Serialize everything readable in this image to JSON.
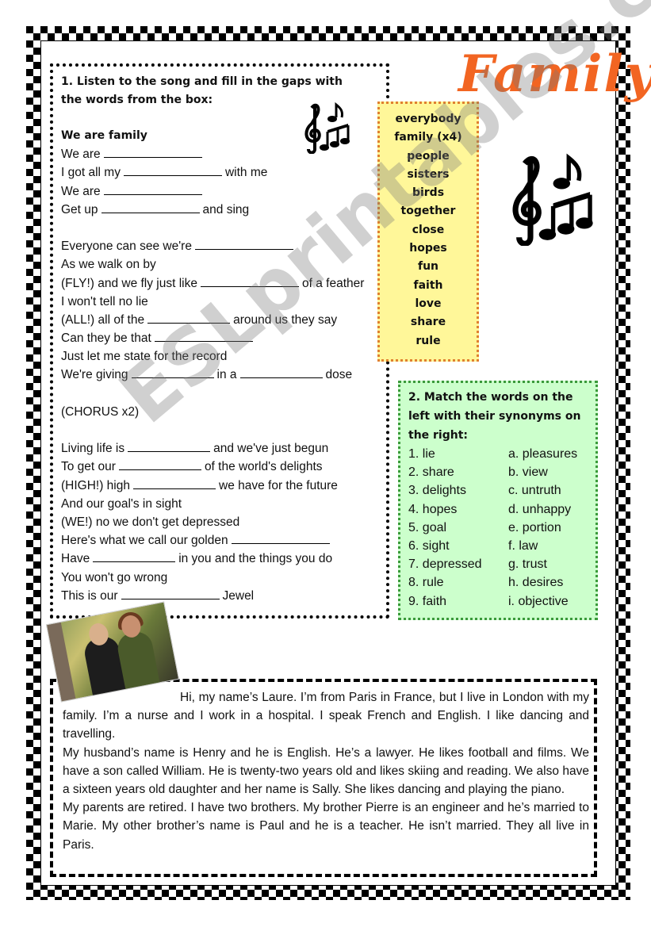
{
  "title": "Family",
  "exercise1": {
    "instruction": "1. Listen to the song and fill in the gaps with the words from the box:",
    "song_title": "We are family",
    "lines": [
      {
        "before": "We are",
        "gaps": 1,
        "mid": "",
        "after": ""
      },
      {
        "before": "I got all my",
        "gaps": 1,
        "mid": "",
        "after": "with me"
      },
      {
        "before": "We are",
        "gaps": 1,
        "mid": "",
        "after": ""
      },
      {
        "before": "Get up",
        "gaps": 1,
        "mid": "",
        "after": "and sing"
      },
      {
        "before": "",
        "gaps": 0,
        "mid": "",
        "after": ""
      },
      {
        "before": "Everyone can see we're",
        "gaps": 1,
        "mid": "",
        "after": ""
      },
      {
        "before": "As we walk on by",
        "gaps": 0,
        "mid": "",
        "after": ""
      },
      {
        "before": "(FLY!) and we fly just like",
        "gaps": 1,
        "mid": "",
        "after": "of a feather"
      },
      {
        "before": "I won't tell no lie",
        "gaps": 0,
        "mid": "",
        "after": ""
      },
      {
        "before": "(ALL!) all of the",
        "gaps": 1,
        "mid": "",
        "after": "around us they say"
      },
      {
        "before": "Can they be that",
        "gaps": 1,
        "mid": "",
        "after": ""
      },
      {
        "before": "Just let me state for the record",
        "gaps": 0,
        "mid": "",
        "after": ""
      },
      {
        "before": "We're giving",
        "gaps": 2,
        "mid": "in a",
        "after": "dose"
      },
      {
        "before": "",
        "gaps": 0,
        "mid": "",
        "after": ""
      },
      {
        "before": "(CHORUS x2)",
        "gaps": 0,
        "mid": "",
        "after": ""
      },
      {
        "before": "",
        "gaps": 0,
        "mid": "",
        "after": ""
      },
      {
        "before": "Living life is",
        "gaps": 1,
        "mid": "",
        "after": "and we've just begun"
      },
      {
        "before": "To get our",
        "gaps": 1,
        "mid": "",
        "after": "of the world's delights"
      },
      {
        "before": "(HIGH!) high",
        "gaps": 1,
        "mid": "",
        "after": "we have for the future"
      },
      {
        "before": "And our goal's in sight",
        "gaps": 0,
        "mid": "",
        "after": ""
      },
      {
        "before": "(WE!) no we don't get depressed",
        "gaps": 0,
        "mid": "",
        "after": ""
      },
      {
        "before": "Here's what we call our golden",
        "gaps": 1,
        "mid": "",
        "after": ""
      },
      {
        "before": "Have",
        "gaps": 1,
        "mid": "",
        "after": "in you and the things you do"
      },
      {
        "before": "You won't go wrong",
        "gaps": 0,
        "mid": "",
        "after": ""
      },
      {
        "before": "This is our",
        "gaps": 1,
        "mid": "",
        "after": "Jewel"
      }
    ]
  },
  "word_box": {
    "words": [
      "everybody",
      "family (x4)",
      "people",
      "sisters",
      "birds",
      "together",
      "close",
      "hopes",
      "fun",
      "faith",
      "love",
      "share",
      "rule"
    ]
  },
  "exercise2": {
    "instruction": "2. Match the words on the left with their synonyms on the right:",
    "left": [
      "1. lie",
      "2. share",
      "3. delights",
      "4. hopes",
      "5. goal",
      "6. sight",
      "7. depressed",
      "8. rule",
      "9. faith"
    ],
    "right": [
      "a. pleasures",
      "b. view",
      "c. untruth",
      "d. unhappy",
      "e. portion",
      "f. law",
      "g. trust",
      "h. desires",
      "i. objective"
    ]
  },
  "reading": {
    "paragraphs": [
      "Hi, my name’s Laure. I’m from Paris in France, but I live in London with my family. I’m a nurse and I work in a hospital. I speak French and English. I like dancing and travelling.",
      "My husband’s name is Henry and he is English. He’s a lawyer. He likes football and films. We have a son called William. He is twenty-two years old and likes skiing and reading. We also have a sixteen years old daughter and her name is Sally. She likes dancing and playing the piano.",
      "My parents are retired. I have two brothers. My brother Pierre is an engineer and he’s married to Marie. My other brother’s name is Paul and he is a teacher. He isn’t married. They all live in Paris."
    ]
  },
  "watermark": "ESLprintables.com",
  "colors": {
    "title": "#f26522",
    "word_box_bg": "#fff799",
    "word_box_border": "#e08030",
    "match_box_bg": "#ccffcc",
    "match_box_border": "#3a9a3a"
  }
}
